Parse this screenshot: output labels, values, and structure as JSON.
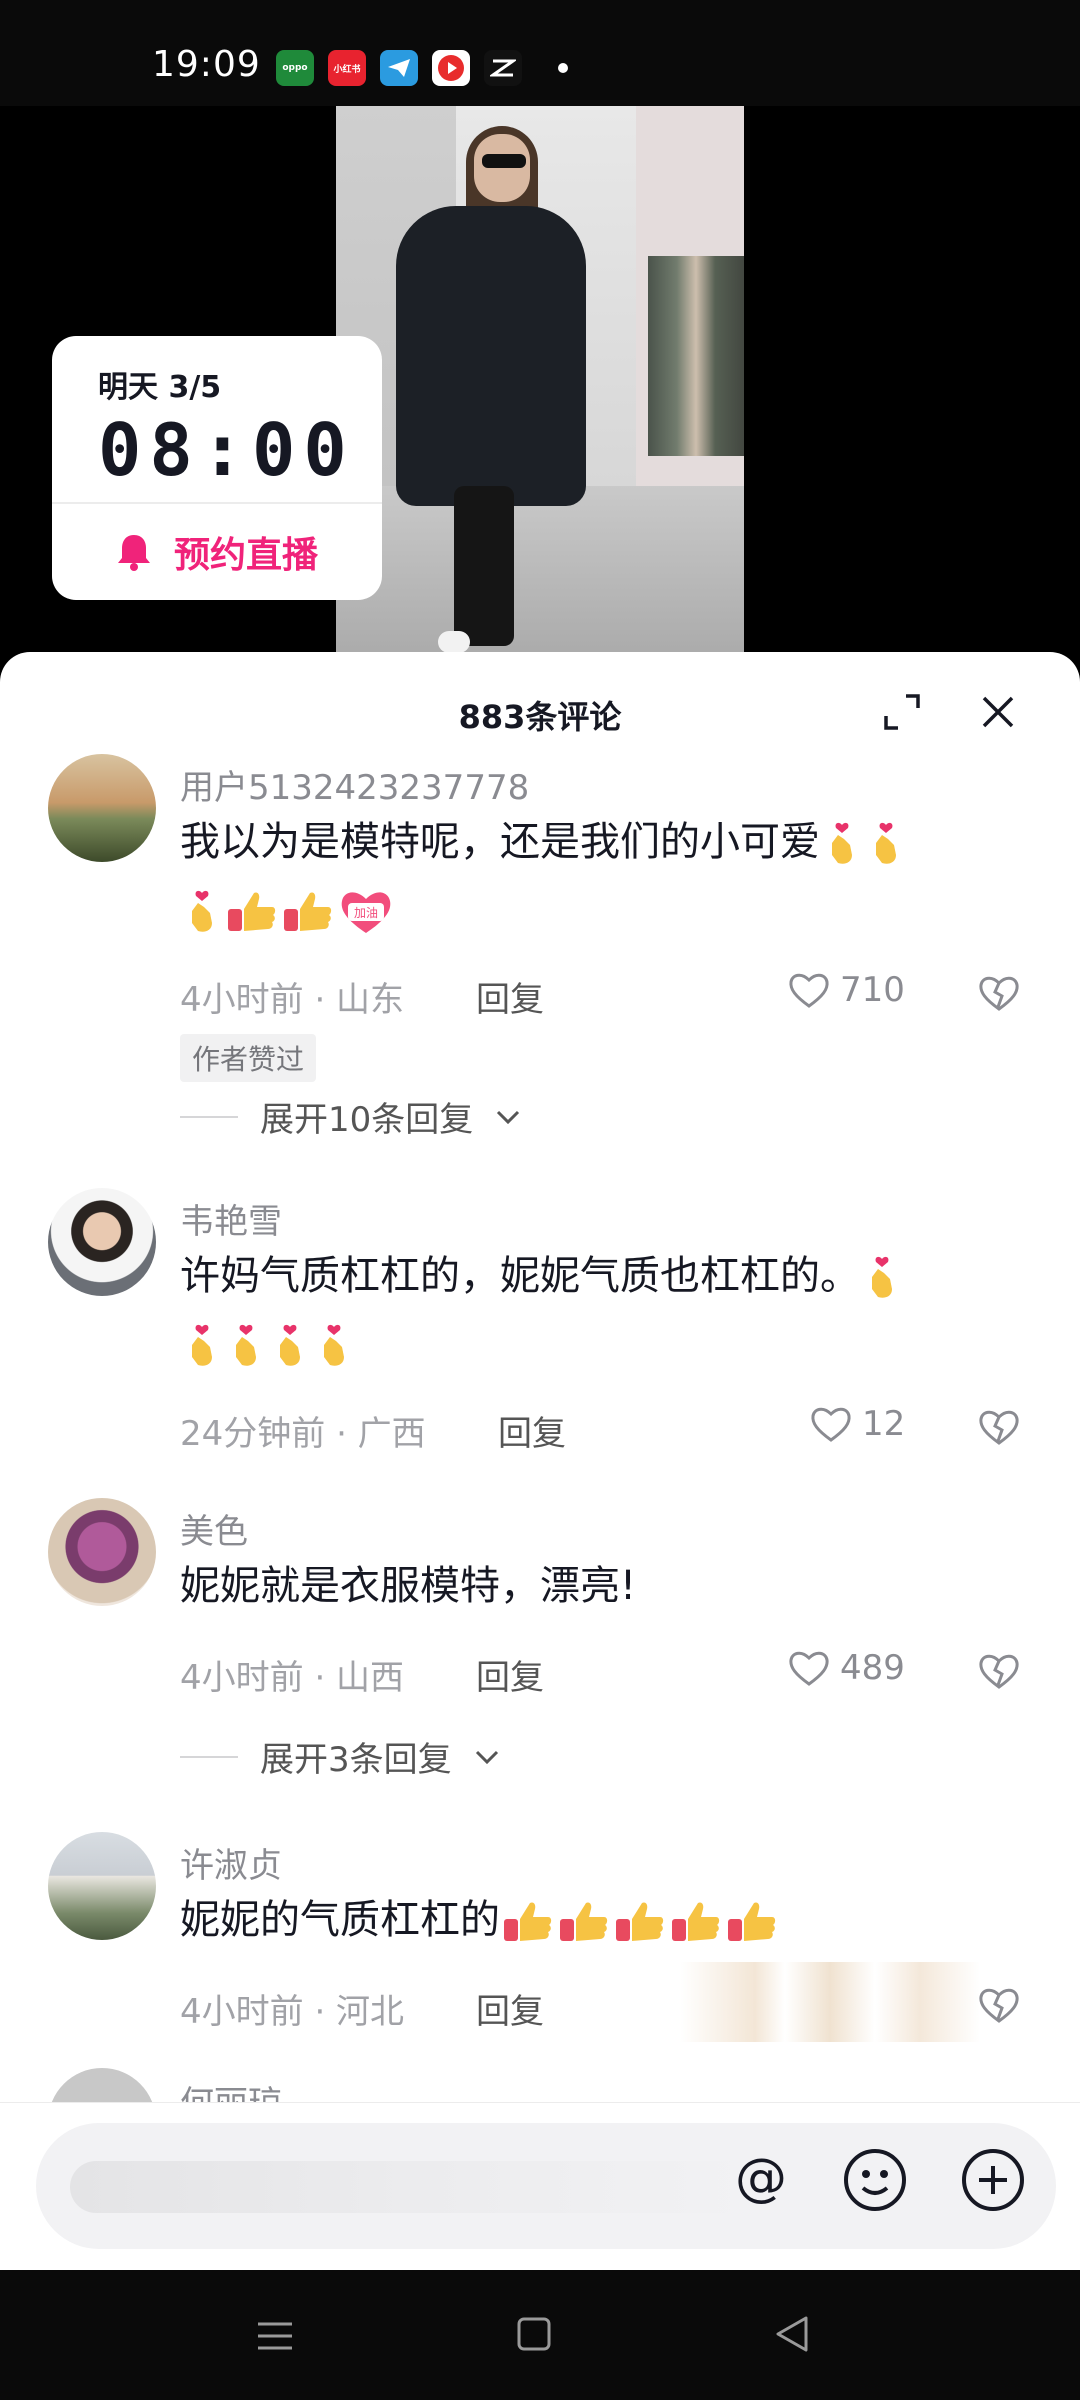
{
  "status_bar": {
    "time": "19:09",
    "app_icons": [
      {
        "name": "oppo-icon",
        "label": "oppo",
        "color": "#1f8a3a"
      },
      {
        "name": "xiaohongshu-icon",
        "label": "小红书",
        "color": "#e8232f"
      },
      {
        "name": "telegram-icon",
        "label": "",
        "color": "#2b9be0"
      },
      {
        "name": "video-app-icon",
        "label": "",
        "color": "#e82c2c"
      },
      {
        "name": "capcut-icon",
        "label": "",
        "color": "#111111"
      }
    ]
  },
  "reserve": {
    "date": "明天 3/5",
    "time": "08:00",
    "button_label": "预约直播",
    "accent_color": "#f0237a"
  },
  "comments_panel": {
    "title": "883条评论"
  },
  "comments": [
    {
      "user": "用户5132423237778",
      "text": "我以为是模特呢，还是我们的小可爱",
      "meta": "4小时前 · 山东",
      "reply": "回复",
      "likes": "710",
      "badge": "作者赞过",
      "expand": "展开10条回复"
    },
    {
      "user": "韦艳雪",
      "text": "许妈气质杠杠的，妮妮气质也杠杠的。",
      "meta": "24分钟前 · 广西",
      "reply": "回复",
      "likes": "12"
    },
    {
      "user": "美色",
      "text": "妮妮就是衣服模特，漂亮!",
      "meta": "4小时前 · 山西",
      "reply": "回复",
      "likes": "489",
      "expand": "展开3条回复"
    },
    {
      "user": "许淑贞",
      "text": "妮妮的气质杠杠的",
      "meta": "4小时前 · 河北",
      "reply": "回复"
    },
    {
      "user": "何丽琼"
    }
  ],
  "emoji_labels": {
    "cheer": "加油"
  },
  "input": {
    "placeholder": "",
    "at_symbol": "@"
  }
}
